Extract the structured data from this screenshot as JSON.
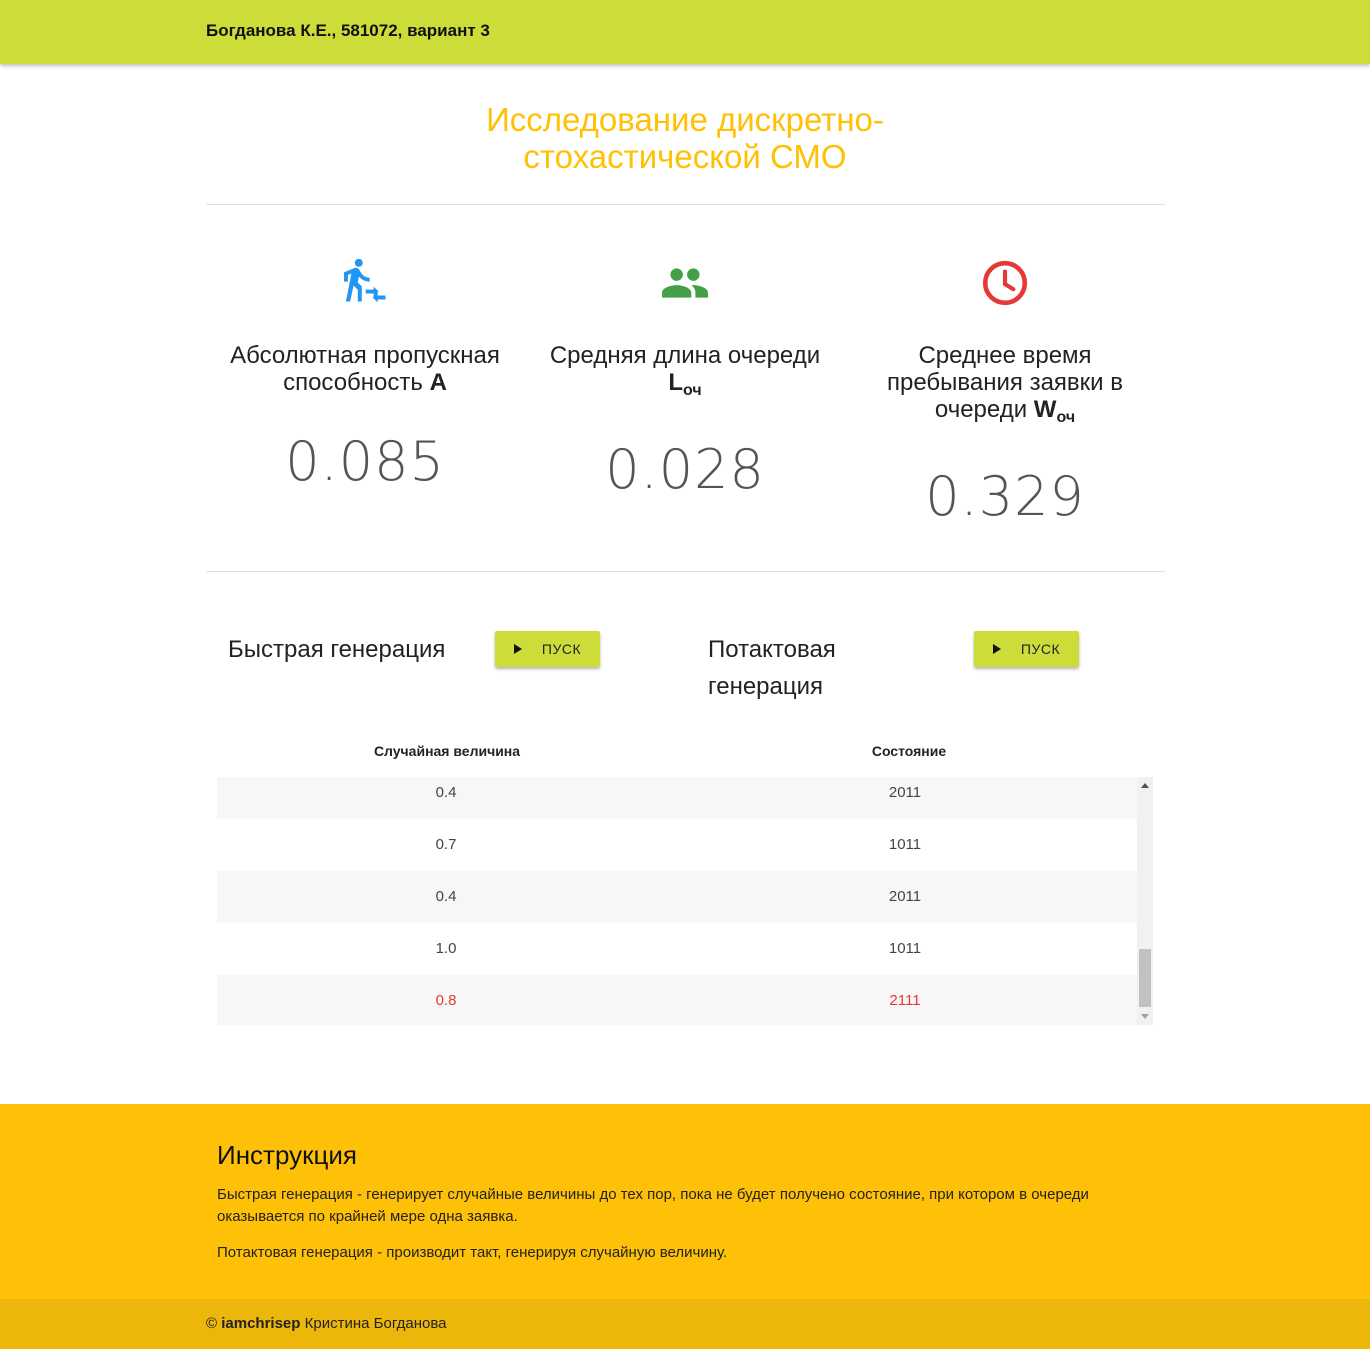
{
  "header": {
    "brand": "Богданова К.Е., 581072, вариант 3"
  },
  "page_title": "Исследование дискретно-стохастической СМО",
  "colors": {
    "primary": "#cddc39",
    "accent": "#ffc107",
    "icon_blue": "#2196f3",
    "icon_green": "#43a047",
    "icon_red": "#e53935"
  },
  "metrics": [
    {
      "icon": "person-transfer-icon",
      "label": "Абсолютная пропускная способность",
      "symbol": "A",
      "sub": "",
      "value": "0.085"
    },
    {
      "icon": "people-icon",
      "label": "Средняя длина очереди",
      "symbol": "L",
      "sub": "оч",
      "value": "0.028"
    },
    {
      "icon": "clock-icon",
      "label": "Среднее время пребывания заявки в очереди",
      "symbol": "W",
      "sub": "оч",
      "value": "0.329"
    }
  ],
  "generation": {
    "fast": {
      "title": "Быстрая генерация",
      "button": "Пуск"
    },
    "step": {
      "title": "Потактовая генерация",
      "button": "Пуск"
    }
  },
  "table": {
    "headers": [
      "Случайная величина",
      "Состояние"
    ],
    "rows": [
      {
        "value": "0.4",
        "state": "2011"
      },
      {
        "value": "0.7",
        "state": "1011"
      },
      {
        "value": "0.4",
        "state": "2011"
      },
      {
        "value": "1.0",
        "state": "1011"
      },
      {
        "value": "0.8",
        "state": "2111",
        "highlight": true
      }
    ]
  },
  "instructions": {
    "title": "Инструкция",
    "p1": "Быстрая генерация - генерирует случайные величины до тех пор, пока не будет получено состояние, при котором в очереди оказывается по крайней мере одна заявка.",
    "p2": "Потактовая генерация - производит такт, генерируя случайную величину."
  },
  "footer": {
    "copyright": "©",
    "author_handle": "iamchrisep",
    "author_name": "Кристина Богданова"
  }
}
